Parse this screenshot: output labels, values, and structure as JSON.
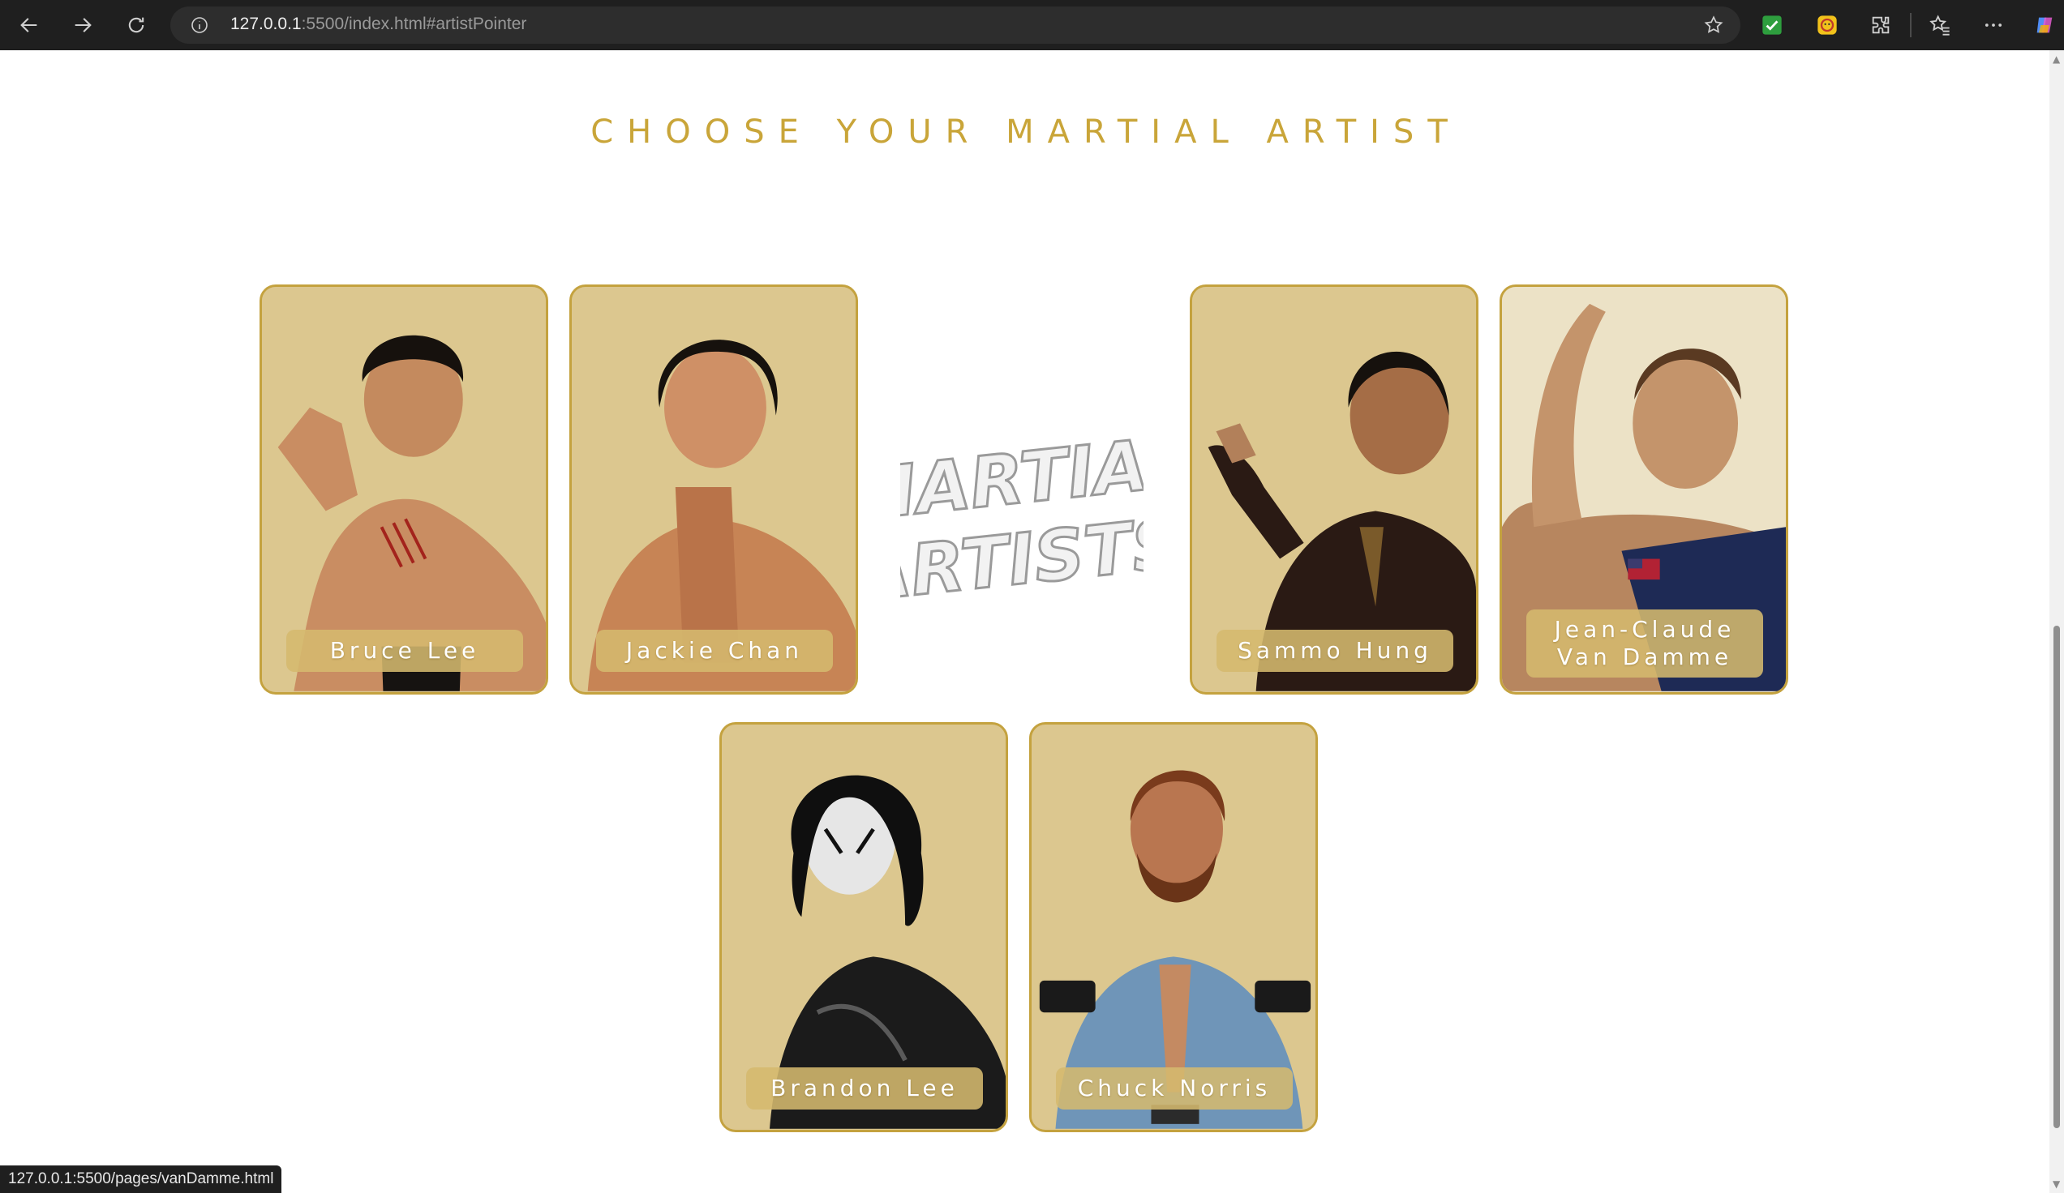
{
  "browser": {
    "url_host": "127.0.0.1",
    "url_rest": ":5500/index.html#artistPointer",
    "icons": [
      "back-icon",
      "forward-icon",
      "refresh-icon",
      "info-icon",
      "star-icon",
      "extension-check-icon",
      "extension-face-icon",
      "extensions-icon",
      "favorites-icon",
      "more-icon",
      "copilot-icon"
    ],
    "status_url": "127.0.0.1:5500/pages/vanDamme.html"
  },
  "page": {
    "title": "CHOOSE YOUR MARTIAL ARTIST",
    "logo_lines": [
      "MARTIAL",
      "ARTISTS"
    ],
    "accent_color": "#c9a539",
    "card_background": "#dcc78f"
  },
  "artists": [
    {
      "name": "Bruce Lee",
      "photo": "shirtless fighter in stance, scratched chest"
    },
    {
      "name": "Jackie Chan",
      "photo": "shirtless fighter with raised palm"
    },
    {
      "name": "Sammo Hung",
      "photo": "man in dark suit with raised hand"
    },
    {
      "name": "Jean-Claude Van Damme",
      "photo": "fighter in tank top with flag tattoo"
    },
    {
      "name": "Brandon Lee",
      "photo": "man with painted white face in leather jacket"
    },
    {
      "name": "Chuck Norris",
      "photo": "bearded man in denim shirt holding guns"
    }
  ]
}
